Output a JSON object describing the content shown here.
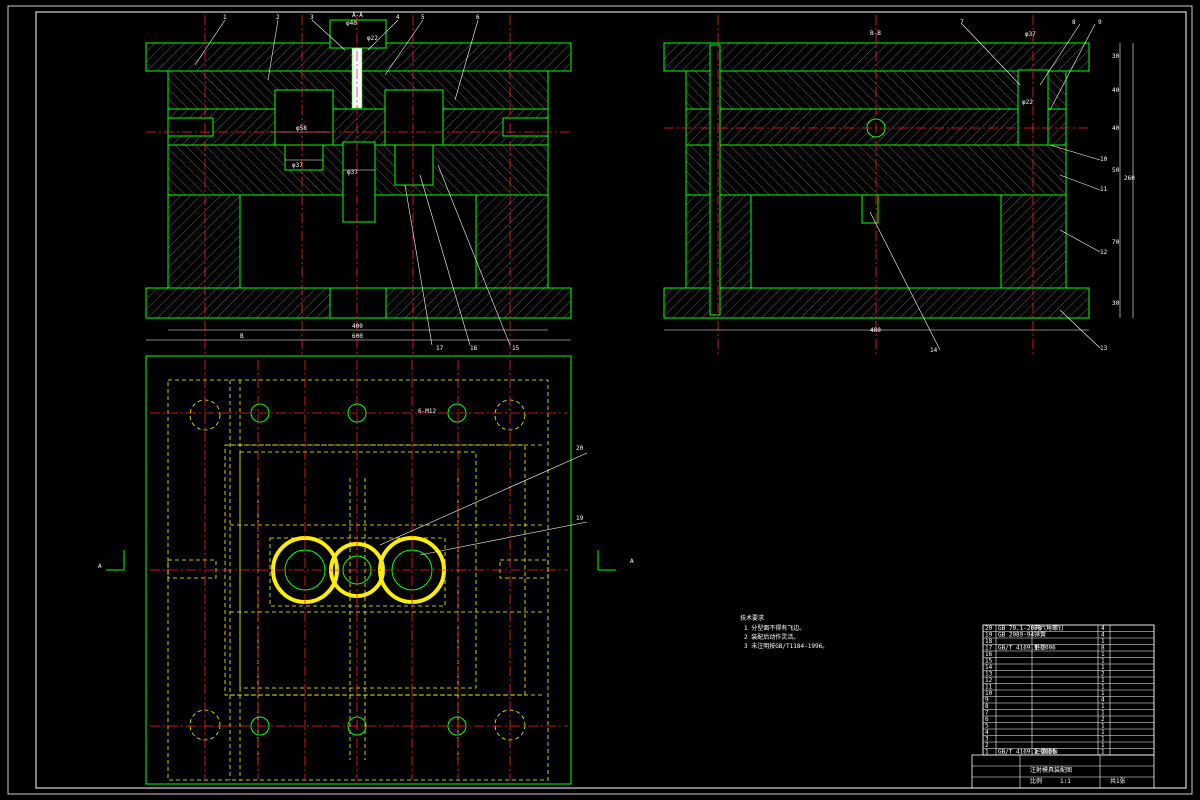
{
  "section_labels": {
    "left_view": "A-A",
    "right_view": "B-B",
    "plan_left_mark": "A",
    "plan_right_mark": "A",
    "cut_mark": "B"
  },
  "part_numbers_top": [
    "1",
    "2",
    "3",
    "4",
    "5",
    "6"
  ],
  "part_numbers_right": [
    "7",
    "8",
    "9",
    "10",
    "11",
    "12",
    "13"
  ],
  "part_numbers_bottom_left": [
    "17",
    "16",
    "15"
  ],
  "part_numbers_bottom_right": "14",
  "part_numbers_plan": [
    "20",
    "19"
  ],
  "dimensions_left": {
    "width_inner": "400",
    "width_outer": "600",
    "dia_a": "φ40",
    "dia_b": "φ58",
    "dia_c": "φ37",
    "dia_d": "φ37",
    "dia_e": "φ22"
  },
  "dimensions_right": {
    "width_inner": "480",
    "dia_top": "φ37",
    "dia_side": "φ22",
    "stack": [
      "30",
      "40",
      "40",
      "50",
      "70",
      "30"
    ],
    "total": "260"
  },
  "plan_note_dim": "6-M12",
  "tech_requirements": {
    "title": "技术要求",
    "items": [
      "1  分型面不得有飞边。",
      "2  装配后动作灵活。",
      "3  未注明按GB/T1184-1996。"
    ]
  },
  "title_block": {
    "drawing_title": "注射模具装配图",
    "scale_label": "比例",
    "scale": "1:1",
    "sheet_label": "共1张"
  },
  "bom_rows": [
    {
      "no": "20",
      "spec": "GB 70.1-2000",
      "name": "内六角螺钉",
      "qty": "4"
    },
    {
      "no": "19",
      "spec": "GB 2089-94",
      "name": "弹簧",
      "qty": "4"
    },
    {
      "no": "18",
      "spec": "",
      "name": "",
      "qty": "1"
    },
    {
      "no": "17",
      "spec": "GB/T 4169.1-2006",
      "name": "推杆",
      "qty": "8"
    },
    {
      "no": "16",
      "spec": "",
      "name": "",
      "qty": "1"
    },
    {
      "no": "15",
      "spec": "",
      "name": "",
      "qty": "1"
    },
    {
      "no": "14",
      "spec": "",
      "name": "",
      "qty": "1"
    },
    {
      "no": "13",
      "spec": "",
      "name": "",
      "qty": "2"
    },
    {
      "no": "12",
      "spec": "",
      "name": "",
      "qty": "1"
    },
    {
      "no": "11",
      "spec": "",
      "name": "",
      "qty": "1"
    },
    {
      "no": "10",
      "spec": "",
      "name": "",
      "qty": "1"
    },
    {
      "no": "9",
      "spec": "",
      "name": "",
      "qty": "4"
    },
    {
      "no": "8",
      "spec": "",
      "name": "",
      "qty": "1"
    },
    {
      "no": "7",
      "spec": "",
      "name": "",
      "qty": "1"
    },
    {
      "no": "6",
      "spec": "",
      "name": "",
      "qty": "2"
    },
    {
      "no": "5",
      "spec": "",
      "name": "",
      "qty": "1"
    },
    {
      "no": "4",
      "spec": "",
      "name": "",
      "qty": "1"
    },
    {
      "no": "3",
      "spec": "",
      "name": "",
      "qty": "1"
    },
    {
      "no": "2",
      "spec": "",
      "name": "",
      "qty": "1"
    },
    {
      "no": "1",
      "spec": "GB/T 4169.1-2006",
      "name": "定模座板",
      "qty": "1"
    }
  ],
  "colors": {
    "background": "#000000",
    "outline": "#00ff00",
    "centerline": "#ff2020",
    "hidden": "#ffff00",
    "text": "#ffffff"
  }
}
